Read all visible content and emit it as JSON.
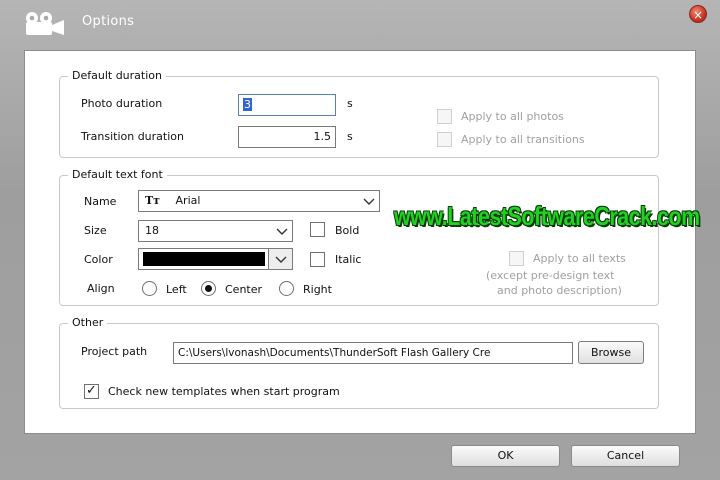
{
  "window": {
    "title": "Options",
    "app_icon": "camera-icon",
    "close_icon": "close-icon",
    "close_symbol": "×"
  },
  "default_duration": {
    "legend": "Default duration",
    "photo_label": "Photo duration",
    "photo_value": "3",
    "photo_unit": "s",
    "transition_label": "Transition duration",
    "transition_value": "1.5",
    "transition_unit": "s",
    "apply_photos_label": "Apply to all photos",
    "apply_transitions_label": "Apply to all transitions",
    "apply_photos_checked": false,
    "apply_transitions_checked": false
  },
  "default_text_font": {
    "legend": "Default text font",
    "name_label": "Name",
    "font_name": "Arial",
    "font_icon_glyph": "Tт",
    "size_label": "Size",
    "size_value": "18",
    "bold_label": "Bold",
    "color_label": "Color",
    "color_value": "#000000",
    "italic_label": "Italic",
    "align_label": "Align",
    "align_options": [
      "Left",
      "Center",
      "Right"
    ],
    "align_selected": "Center",
    "apply_texts_label": "Apply to all texts",
    "apply_texts_note_1": "(except pre-design text",
    "apply_texts_note_2": "and photo description)"
  },
  "other": {
    "legend": "Other",
    "project_path_label": "Project path",
    "project_path_value": "C:\\Users\\lvonash\\Documents\\ThunderSoft Flash Gallery Cre",
    "browse_label": "Browse",
    "check_templates_label": "Check new templates when start program",
    "check_templates_checked": true,
    "check_mark": "✓"
  },
  "footer": {
    "ok_label": "OK",
    "cancel_label": "Cancel"
  },
  "watermark": {
    "text": "www.LatestSoftwareCrack.com",
    "color": "#1fd21f"
  }
}
